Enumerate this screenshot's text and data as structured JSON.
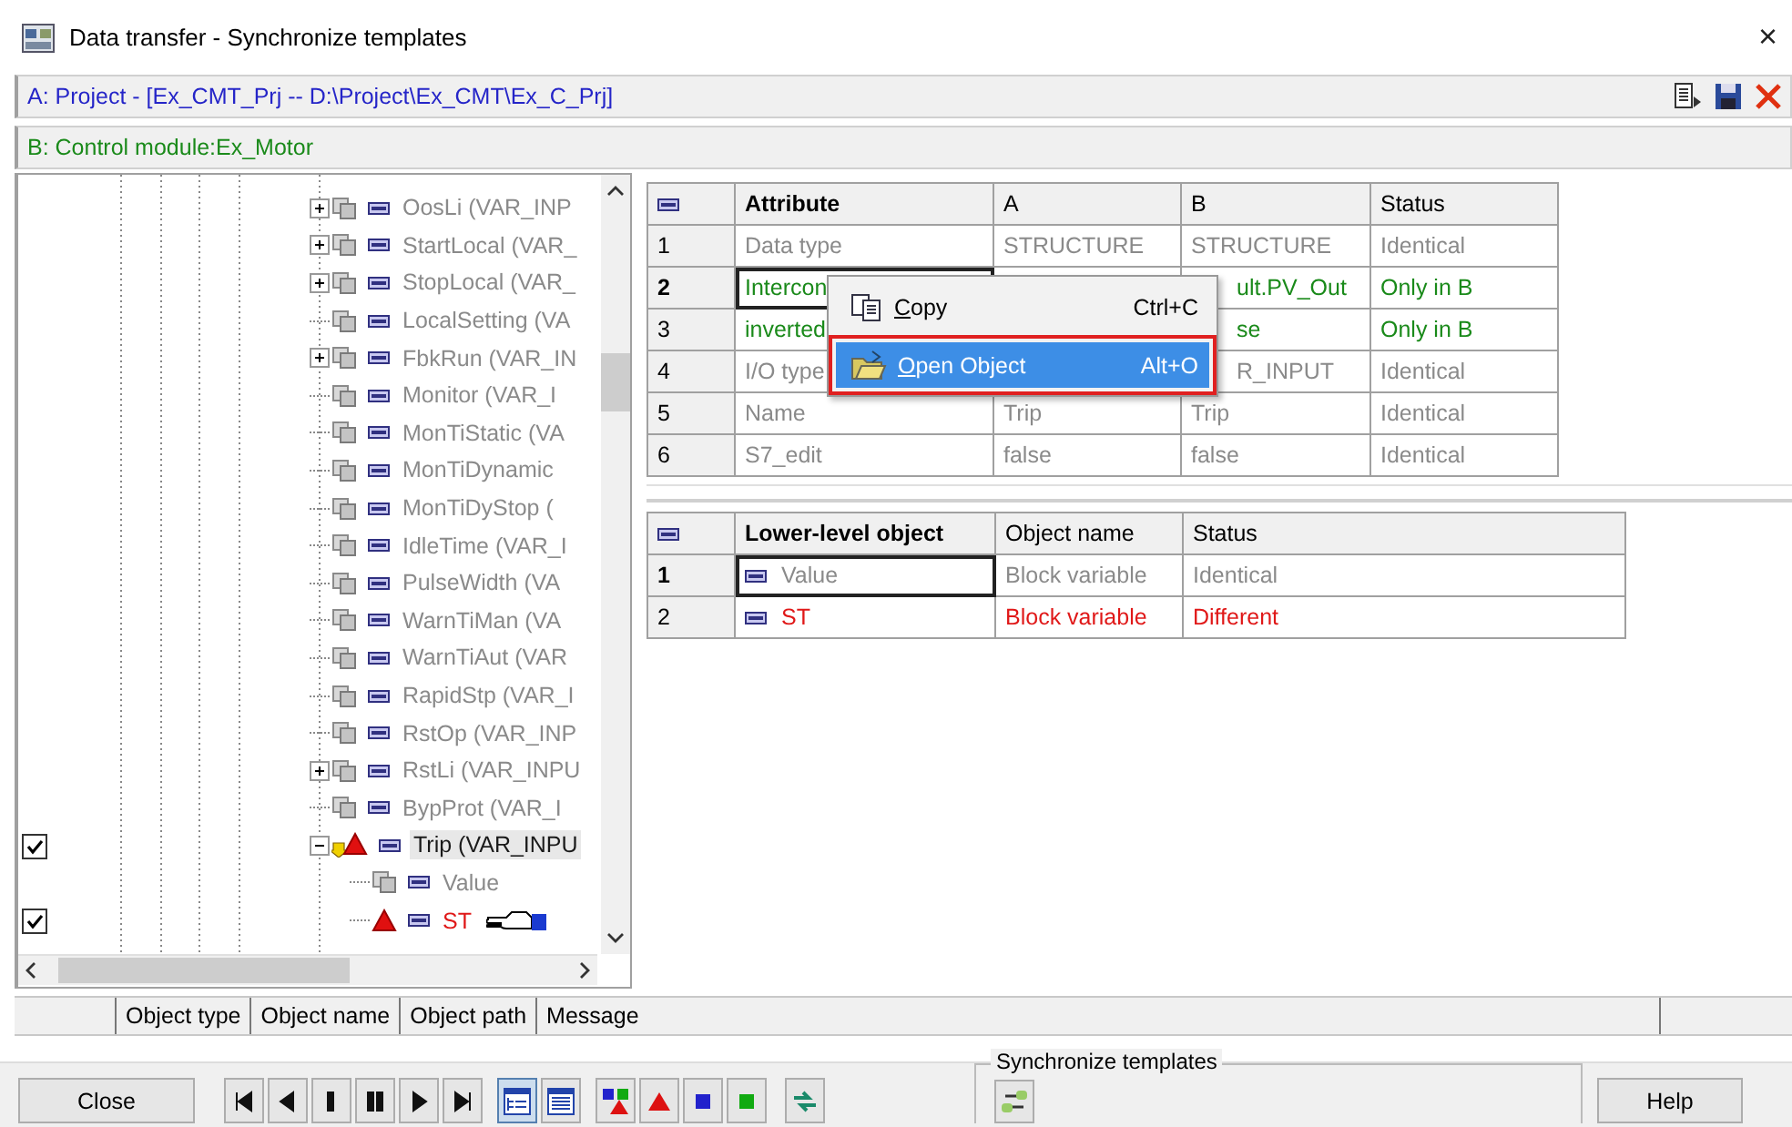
{
  "window": {
    "title": "Data transfer - Synchronize templates",
    "close": "×"
  },
  "project_a": {
    "label": "A: Project - [Ex_CMT_Prj -- D:\\Project\\Ex_CMT\\Ex_C_Prj]"
  },
  "project_b": {
    "label": "B: Control module:Ex_Motor"
  },
  "tree": {
    "items": [
      {
        "label": "OosLi (VAR_INP",
        "kind": "block",
        "different": false,
        "selected": false,
        "expanded": false
      },
      {
        "label": "StartLocal (VAR_",
        "kind": "block",
        "different": false,
        "selected": false,
        "expanded": false
      },
      {
        "label": "StopLocal (VAR_",
        "kind": "block",
        "different": false,
        "selected": false,
        "expanded": false
      },
      {
        "label": "LocalSetting (VA",
        "kind": "block",
        "different": false,
        "selected": false
      },
      {
        "label": "FbkRun (VAR_IN",
        "kind": "block",
        "different": false,
        "selected": false,
        "expanded": false
      },
      {
        "label": "Monitor (VAR_I",
        "kind": "block",
        "different": false,
        "selected": false
      },
      {
        "label": "MonTiStatic (VA",
        "kind": "block",
        "different": false,
        "selected": false
      },
      {
        "label": "MonTiDynamic",
        "kind": "block",
        "different": false,
        "selected": false
      },
      {
        "label": "MonTiDyStop (",
        "kind": "block",
        "different": false,
        "selected": false
      },
      {
        "label": "IdleTime (VAR_I",
        "kind": "block",
        "different": false,
        "selected": false
      },
      {
        "label": "PulseWidth (VA",
        "kind": "block",
        "different": false,
        "selected": false
      },
      {
        "label": "WarnTiMan (VA",
        "kind": "block",
        "different": false,
        "selected": false
      },
      {
        "label": "WarnTiAut (VAR",
        "kind": "block",
        "different": false,
        "selected": false
      },
      {
        "label": "RapidStp (VAR_I",
        "kind": "block",
        "different": false,
        "selected": false
      },
      {
        "label": "RstOp (VAR_INP",
        "kind": "block",
        "different": false,
        "selected": false
      },
      {
        "label": "RstLi (VAR_INPU",
        "kind": "block",
        "different": false,
        "selected": false,
        "expanded": false
      },
      {
        "label": "BypProt (VAR_I",
        "kind": "block",
        "different": false,
        "selected": false
      },
      {
        "label": "Trip (VAR_INPU",
        "kind": "triangle-arrow",
        "different": true,
        "selected": true,
        "expanded": true,
        "checked": true,
        "children": [
          {
            "label": "Value",
            "kind": "block",
            "different": false,
            "selected": false
          },
          {
            "label": "ST",
            "kind": "triangle",
            "different": true,
            "selected": false,
            "checked": true,
            "pointer": true
          }
        ]
      }
    ]
  },
  "attributes": {
    "columns": [
      "Attribute",
      "A",
      "B",
      "Status"
    ],
    "rows": [
      {
        "number": "1",
        "attribute": "Data type",
        "a": "STRUCTURE",
        "b": "STRUCTURE",
        "status": "Identical",
        "color": "#8a8a8a",
        "current": false
      },
      {
        "number": "2",
        "attribute": "Intercon",
        "b": "ult.PV_Out",
        "status": "Only in B",
        "color": "#1a8a1a",
        "current": true
      },
      {
        "number": "3",
        "attribute": "inverted",
        "b": "se",
        "status": "Only in B",
        "color": "#1a8a1a",
        "current": false
      },
      {
        "number": "4",
        "attribute": "I/O type",
        "b": "R_INPUT",
        "status": "Identical",
        "color": "#8a8a8a",
        "current": false
      },
      {
        "number": "5",
        "attribute": "Name",
        "a": "Trip",
        "b": "Trip",
        "status": "Identical",
        "color": "#8a8a8a",
        "current": false
      },
      {
        "number": "6",
        "attribute": "S7_edit",
        "a": "false",
        "b": "false",
        "status": "Identical",
        "color": "#8a8a8a",
        "current": false
      }
    ]
  },
  "context_menu": {
    "items": [
      {
        "label": "Copy",
        "shortcut": "Ctrl+C",
        "kind": "copy",
        "selected": false
      },
      {
        "label": "Open Object",
        "shortcut": "Alt+O",
        "kind": "folder",
        "selected": true
      }
    ]
  },
  "lower_objects": {
    "columns": [
      "Lower-level object",
      "Object name",
      "Status"
    ],
    "rows": [
      {
        "number": "1",
        "object": "Value",
        "object_name": "Block variable",
        "status": "Identical",
        "color": "#8a8a8a",
        "current": true
      },
      {
        "number": "2",
        "object": "ST",
        "object_name": "Block variable",
        "status": "Different",
        "color": "#e01818",
        "current": false
      }
    ]
  },
  "messages": {
    "columns": [
      "Object type",
      "Object name",
      "Object path",
      "Message"
    ]
  },
  "footer": {
    "close": "Close",
    "navigation": [
      {
        "kind": "first"
      },
      {
        "kind": "prev"
      },
      {
        "kind": "stop"
      },
      {
        "kind": "pause"
      },
      {
        "kind": "next"
      },
      {
        "kind": "last"
      }
    ],
    "views": [
      {
        "kind": "tree",
        "selected": true
      },
      {
        "kind": "list",
        "selected": false
      }
    ],
    "filters": [
      {
        "kind": "all"
      },
      {
        "kind": "triangle"
      },
      {
        "kind": "blue"
      },
      {
        "kind": "green"
      }
    ],
    "sync_group": {
      "title": "Synchronize templates"
    },
    "help": "Help"
  }
}
